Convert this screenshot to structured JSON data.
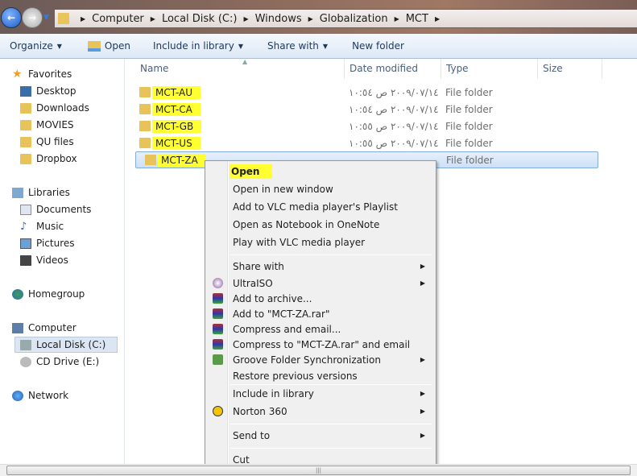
{
  "address": {
    "crumbs": [
      "Computer",
      "Local Disk (C:)",
      "Windows",
      "Globalization",
      "MCT"
    ]
  },
  "toolbar": {
    "organize": "Organize",
    "open": "Open",
    "include": "Include in library",
    "share": "Share with",
    "new_folder": "New folder"
  },
  "sidebar": {
    "favorites": "Favorites",
    "fav_items": [
      "Desktop",
      "Downloads",
      "MOVIES",
      "QU files",
      "Dropbox"
    ],
    "libraries": "Libraries",
    "lib_items": [
      "Documents",
      "Music",
      "Pictures",
      "Videos"
    ],
    "homegroup": "Homegroup",
    "computer": "Computer",
    "comp_items": [
      "Local Disk (C:)",
      "CD Drive (E:)"
    ],
    "network": "Network"
  },
  "columns": {
    "name": "Name",
    "date": "Date modified",
    "type": "Type",
    "size": "Size"
  },
  "files": [
    {
      "name": "MCT-AU",
      "date": "٢٠٠٩/٠٧/١٤ ص ١٠:٥٤",
      "type": "File folder"
    },
    {
      "name": "MCT-CA",
      "date": "٢٠٠٩/٠٧/١٤ ص ١٠:٥٤",
      "type": "File folder"
    },
    {
      "name": "MCT-GB",
      "date": "٢٠٠٩/٠٧/١٤ ص ١٠:٥٥",
      "type": "File folder"
    },
    {
      "name": "MCT-US",
      "date": "٢٠٠٩/٠٧/١٤ ص ١٠:٥٥",
      "type": "File folder"
    },
    {
      "name": "MCT-ZA",
      "date": "",
      "type": "File folder"
    }
  ],
  "menu": {
    "open": "Open",
    "open_new": "Open in new window",
    "vlc_playlist": "Add to VLC media player's Playlist",
    "onenote": "Open as Notebook in OneNote",
    "vlc_play": "Play with VLC media player",
    "share": "Share with",
    "ultraiso": "UltraISO",
    "archive": "Add to archive...",
    "add_rar": "Add to \"MCT-ZA.rar\"",
    "compress_email": "Compress and email...",
    "compress_rar_email": "Compress to \"MCT-ZA.rar\" and email",
    "groove": "Groove Folder Synchronization",
    "restore": "Restore previous versions",
    "include": "Include in library",
    "norton": "Norton 360",
    "send": "Send to",
    "cut": "Cut"
  },
  "colors": {
    "highlight": "#ffff32",
    "selection": "#cde0f7"
  }
}
